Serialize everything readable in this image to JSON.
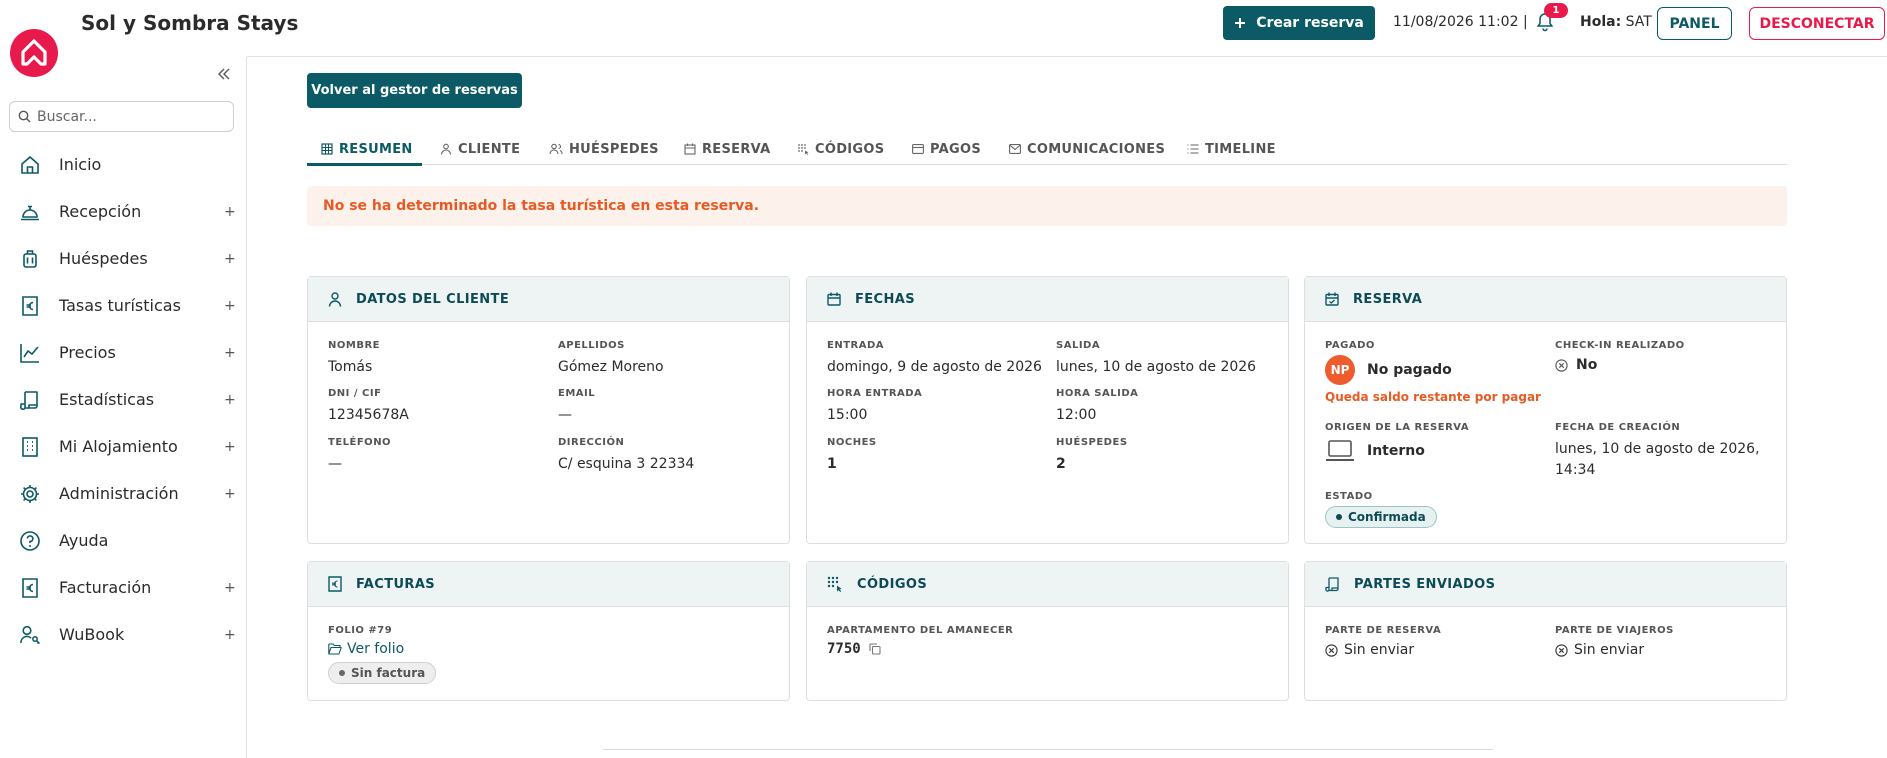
{
  "brand": {
    "name": "Sol y Sombra Stays"
  },
  "topbar": {
    "create_label": "Crear reserva",
    "datetime": "11/08/2026 11:02 |",
    "notification_count": "1",
    "hola_label": "Hola:",
    "user": "SAT",
    "panel_label": "PANEL",
    "logout_label": "DESCONECTAR"
  },
  "sidebar": {
    "search_placeholder": "Buscar...",
    "items": [
      {
        "label": "Inicio",
        "icon": "home-icon",
        "expandable": false
      },
      {
        "label": "Recepción",
        "icon": "bell-desk-icon",
        "expandable": true
      },
      {
        "label": "Huéspedes",
        "icon": "luggage-icon",
        "expandable": true
      },
      {
        "label": "Tasas turísticas",
        "icon": "euro-receipt-icon",
        "expandable": true
      },
      {
        "label": "Precios",
        "icon": "line-chart-icon",
        "expandable": true
      },
      {
        "label": "Estadísticas",
        "icon": "scroll-icon",
        "expandable": true
      },
      {
        "label": "Mi Alojamiento",
        "icon": "building-icon",
        "expandable": true
      },
      {
        "label": "Administración",
        "icon": "gear-icon",
        "expandable": true
      },
      {
        "label": "Ayuda",
        "icon": "help-icon",
        "expandable": false
      },
      {
        "label": "Facturación",
        "icon": "euro-receipt-icon",
        "expandable": true
      },
      {
        "label": "WuBook",
        "icon": "user-key-icon",
        "expandable": true
      }
    ],
    "plus": "+"
  },
  "main": {
    "back_label": "Volver al gestor de reservas",
    "tabs": [
      {
        "label": "RESUMEN",
        "icon": "grid-icon",
        "active": true
      },
      {
        "label": "CLIENTE",
        "icon": "user-icon",
        "active": false
      },
      {
        "label": "HUÉSPEDES",
        "icon": "users-icon",
        "active": false
      },
      {
        "label": "RESERVA",
        "icon": "calendar-icon",
        "active": false
      },
      {
        "label": "CÓDIGOS",
        "icon": "keypad-icon",
        "active": false
      },
      {
        "label": "PAGOS",
        "icon": "card-icon",
        "active": false
      },
      {
        "label": "COMUNICACIONES",
        "icon": "mail-icon",
        "active": false
      },
      {
        "label": "TIMELINE",
        "icon": "list-icon",
        "active": false
      }
    ],
    "alert": "No se ha determinado la tasa turística en esta reserva."
  },
  "cards": {
    "cliente": {
      "title": "DATOS DEL CLIENTE",
      "nombre_k": "NOMBRE",
      "nombre_v": "Tomás",
      "apellidos_k": "APELLIDOS",
      "apellidos_v": "Gómez Moreno",
      "dni_k": "DNI / CIF",
      "dni_v": "12345678A",
      "email_k": "EMAIL",
      "email_v": "—",
      "tel_k": "TELÉFONO",
      "tel_v": "—",
      "dir_k": "DIRECCIÓN",
      "dir_v": "C/ esquina 3 22334"
    },
    "fechas": {
      "title": "FECHAS",
      "entrada_k": "ENTRADA",
      "entrada_v": "domingo, 9 de agosto de 2026",
      "salida_k": "SALIDA",
      "salida_v": "lunes, 10 de agosto de 2026",
      "hentrada_k": "HORA ENTRADA",
      "hentrada_v": "15:00",
      "hsalida_k": "HORA SALIDA",
      "hsalida_v": "12:00",
      "noches_k": "NOCHES",
      "noches_v": "1",
      "huespedes_k": "HUÉSPEDES",
      "huespedes_v": "2"
    },
    "reserva": {
      "title": "RESERVA",
      "pagado_k": "PAGADO",
      "pagado_initials": "NP",
      "pagado_v": "No pagado",
      "saldo_note": "Queda saldo restante por pagar",
      "checkin_k": "CHECK-IN REALIZADO",
      "checkin_v": "No",
      "origen_k": "ORIGEN DE LA RESERVA",
      "origen_v": "Interno",
      "creacion_k": "FECHA DE CREACIÓN",
      "creacion_v": "lunes, 10 de agosto de 2026, 14:34",
      "estado_k": "ESTADO",
      "estado_v": "Confirmada"
    },
    "facturas": {
      "title": "FACTURAS",
      "folio_k": "FOLIO #79",
      "ver_folio": "Ver folio",
      "badge": "Sin factura"
    },
    "codigos": {
      "title": "CÓDIGOS",
      "apt_k": "APARTAMENTO DEL AMANECER",
      "apt_code": "7750"
    },
    "partes": {
      "title": "PARTES ENVIADOS",
      "reserva_k": "PARTE DE RESERVA",
      "reserva_v": "Sin enviar",
      "viajeros_k": "PARTE DE VIAJEROS",
      "viajeros_v": "Sin enviar"
    }
  },
  "colors": {
    "primary": "#0c5a66",
    "accent": "#e8194b",
    "warning": "#e85a23",
    "card_header": "#eef3f4"
  }
}
